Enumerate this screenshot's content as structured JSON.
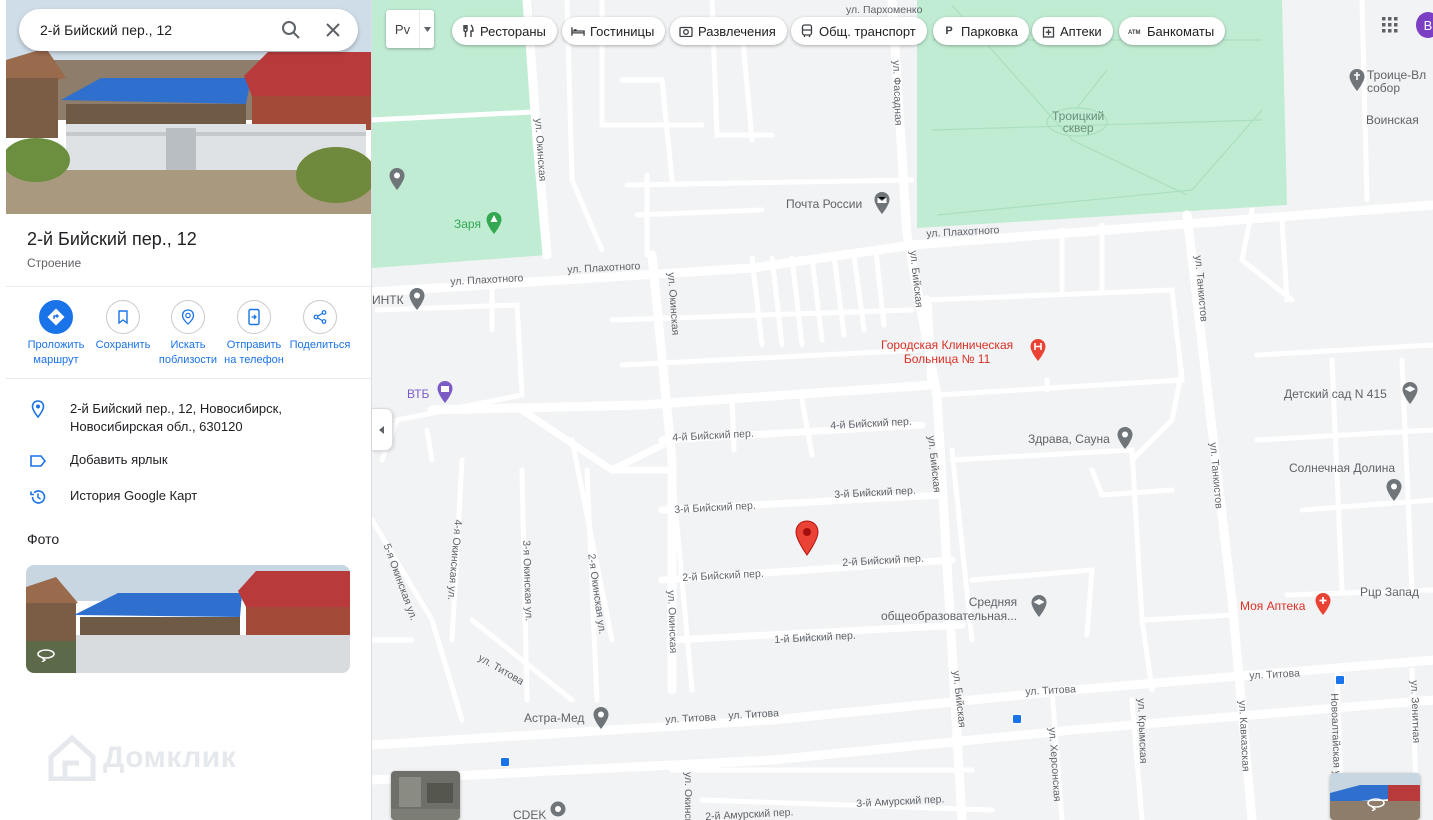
{
  "search": {
    "query": "2-й Бийский пер., 12"
  },
  "place": {
    "title": "2-й Бийский пер., 12",
    "type": "Строение"
  },
  "actions": [
    {
      "line1": "Проложить",
      "line2": "маршрут"
    },
    {
      "line1": "Сохранить",
      "line2": ""
    },
    {
      "line1": "Искать",
      "line2": "поблизости"
    },
    {
      "line1": "Отправить",
      "line2": "на телефон"
    },
    {
      "line1": "Поделиться",
      "line2": ""
    }
  ],
  "info": {
    "address_line1": "2-й Бийский пер., 12, Новосибирск,",
    "address_line2": "Новосибирская обл., 630120",
    "add_label": "Добавить ярлык",
    "history": "История Google Карт"
  },
  "photos": {
    "heading": "Фото"
  },
  "watermark": "Домклик",
  "layer": {
    "label": "Рv"
  },
  "chips": [
    "Рестораны",
    "Гостиницы",
    "Развлечения",
    "Общ. транспорт",
    "Парковка",
    "Аптеки",
    "Банкоматы"
  ],
  "chip_icons": [
    "fork-knife-icon",
    "bed-icon",
    "camera-icon",
    "bus-icon",
    "P",
    "pharmacy-icon",
    "atm-icon"
  ],
  "avatar_letter": "В",
  "colors": {
    "accent": "#1a73e8",
    "park": "#c0ecd3",
    "red_pin": "#ea4335",
    "map_bg": "#f2f3f4"
  },
  "map": {
    "streets": {
      "parkhomenko": "ул. Пархоменко",
      "fasadnaya": "ул. Фасадная",
      "okinskaya_top": "ул. Окинская",
      "plakhotnogo_1": "ул. Плахотного",
      "plakhotnogo_2": "ул. Плахотного",
      "plakhotnogo_3": "ул. Плахотного",
      "biyskaya_top": "ул. Бийская",
      "okinskaya_mid": "ул. Окинская",
      "tankistov_top": "ул. Танкистов",
      "b4_left": "4-й Бийский пер.",
      "b4_right": "4-й Бийский пер.",
      "biyskaya_mid": "ул. Бийская",
      "tankistov_mid": "ул. Танкистов",
      "b3_left": "3-й Бийский пер.",
      "b3_right": "3-й Бийский пер.",
      "b2_left": "2-й Бийский пер.",
      "b2_right": "2-й Бийский пер.",
      "b1": "1-й Бийский пер.",
      "okinskaya_5": "5-я Окинская ул.",
      "okinskaya_4": "4-я Окинская ул.",
      "okinskaya_3": "3-я Окинская ул.",
      "okinskaya_2": "2-я Окинская ул.",
      "okinskaya_low": "ул. Окинская",
      "titova_1": "ул. Титова",
      "titova_2": "ул. Титова",
      "titova_3": "ул. Титова",
      "titova_4": "ул. Титова",
      "titova_5": "ул. Титова",
      "biyskaya_low": "ул. Бийская",
      "khersonskaya": "ул. Херсонская",
      "krymskaya": "ул. Крымская",
      "kavkazskaya": "ул. Кавказская",
      "novoaltayskaya": "Новоалтайская ул.",
      "zenitnaya": "ул. Зенитная",
      "amursky_2": "2-й Амурский пер.",
      "amursky_3": "3-й Амурский пер.",
      "okinskaya_bottom": "ул. Окинская",
      "voinskaya": "Воинская"
    },
    "pois": {
      "troitse": "Троице-Вл\nсобор",
      "troitsky": "Троицкий\nсквер",
      "pochta": "Почта России",
      "zarya": "Заря",
      "intk": "ИНТК",
      "vtb": "ВТБ",
      "hospital": "Городская Клиническая\nБольница № 11",
      "kindergarten": "Детский сад N 415",
      "sauna": "Здрава, Сауна",
      "solnechnaya": "Солнечная Долина",
      "school": "Средняя\nобщеобразовательная...",
      "apteka": "Моя Аптека",
      "rcp": "Рцр Запад",
      "astra": "Астра-Мед",
      "cdek": "CDEK"
    }
  }
}
